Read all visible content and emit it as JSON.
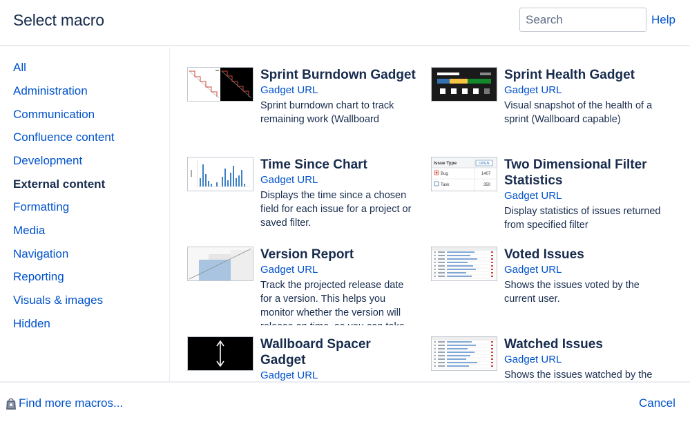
{
  "header": {
    "title": "Select macro",
    "search_placeholder": "Search",
    "help_label": "Help"
  },
  "sidebar": {
    "categories": [
      {
        "label": "All",
        "active": false
      },
      {
        "label": "Administration",
        "active": false
      },
      {
        "label": "Communication",
        "active": false
      },
      {
        "label": "Confluence content",
        "active": false
      },
      {
        "label": "Development",
        "active": false
      },
      {
        "label": "External content",
        "active": true
      },
      {
        "label": "Formatting",
        "active": false
      },
      {
        "label": "Media",
        "active": false
      },
      {
        "label": "Navigation",
        "active": false
      },
      {
        "label": "Reporting",
        "active": false
      },
      {
        "label": "Visuals & images",
        "active": false
      },
      {
        "label": "Hidden",
        "active": false
      }
    ]
  },
  "macros": [
    {
      "name": "Sprint Burndown Gadget",
      "type": "Gadget URL",
      "description": "Sprint burndown chart to track remaining work (Wallboard capable)",
      "thumbnail": "burndown-chart"
    },
    {
      "name": "Sprint Health Gadget",
      "type": "Gadget URL",
      "description": "Visual snapshot of the health of a sprint (Wallboard capable)",
      "thumbnail": "health-bars"
    },
    {
      "name": "Time Since Chart",
      "type": "Gadget URL",
      "description": "Displays the time since a chosen field for each issue for a project or saved filter.",
      "thumbnail": "bar-chart"
    },
    {
      "name": "Two Dimensional Filter Statistics",
      "type": "Gadget URL",
      "description": "Display statistics of issues returned from specified filter",
      "thumbnail": "issue-type-table",
      "thumb_text": {
        "header": "Issue Type",
        "badge": "OPEN",
        "rows": [
          {
            "label": "Bug",
            "value": "1407"
          },
          {
            "label": "Task",
            "value": "350"
          }
        ]
      }
    },
    {
      "name": "Version Report",
      "type": "Gadget URL",
      "description": "Track the projected release date for a version. This helps you monitor whether the version will release on time, so you can take action if work is falling behind.",
      "thumbnail": "version-chart"
    },
    {
      "name": "Voted Issues",
      "type": "Gadget URL",
      "description": "Shows the issues voted by the current user.",
      "thumbnail": "issue-list"
    },
    {
      "name": "Wallboard Spacer Gadget",
      "type": "Gadget URL",
      "description": "",
      "thumbnail": "spacer-arrow"
    },
    {
      "name": "Watched Issues",
      "type": "Gadget URL",
      "description": "Shows the issues watched by the current user.",
      "thumbnail": "issue-list"
    }
  ],
  "footer": {
    "find_more_label": "Find more macros...",
    "cancel_label": "Cancel"
  },
  "colors": {
    "link": "#0052CC",
    "text": "#172B4D",
    "border": "#c1c7d0"
  }
}
